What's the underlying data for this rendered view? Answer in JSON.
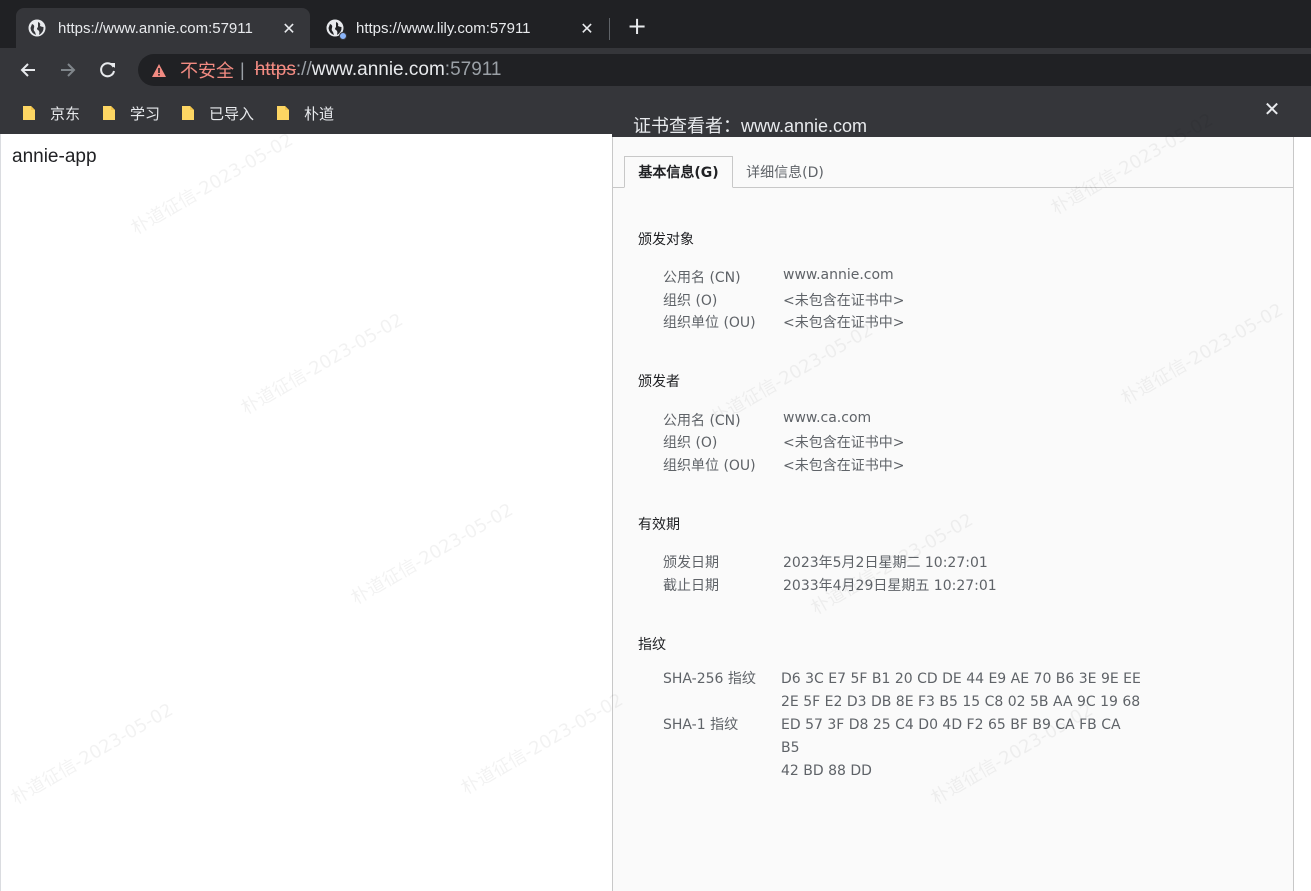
{
  "tabs": [
    {
      "title": "https://www.annie.com:57911",
      "close": "✕"
    },
    {
      "title": "https://www.lily.com:57911",
      "close": "✕"
    }
  ],
  "newtab": "+",
  "omnibox": {
    "security_label": "不安全",
    "pipe": "|",
    "scheme": "https",
    "sep": "://",
    "host": "www.annie.com",
    "port": ":57911"
  },
  "bookmarks": [
    {
      "label": "京东"
    },
    {
      "label": "学习"
    },
    {
      "label": "已导入"
    },
    {
      "label": "朴道"
    }
  ],
  "page": {
    "text": "annie-app"
  },
  "dialog": {
    "title": "证书查看者：www.annie.com",
    "close": "✕",
    "tab_general": "基本信息(G)",
    "tab_details": "详细信息(D)",
    "issued_to": {
      "title": "颁发对象",
      "rows": [
        {
          "k": "公用名 (CN)",
          "v": "www.annie.com"
        },
        {
          "k": "组织 (O)",
          "v": "<未包含在证书中>"
        },
        {
          "k": "组织单位 (OU)",
          "v": "<未包含在证书中>"
        }
      ]
    },
    "issued_by": {
      "title": "颁发者",
      "rows": [
        {
          "k": "公用名 (CN)",
          "v": "www.ca.com"
        },
        {
          "k": "组织 (O)",
          "v": "<未包含在证书中>"
        },
        {
          "k": "组织单位 (OU)",
          "v": "<未包含在证书中>"
        }
      ]
    },
    "validity": {
      "title": "有效期",
      "rows": [
        {
          "k": "颁发日期",
          "v": "2023年5月2日星期二 10:27:01"
        },
        {
          "k": "截止日期",
          "v": "2033年4月29日星期五 10:27:01"
        }
      ]
    },
    "fingerprints": {
      "title": "指纹",
      "sha256_label": "SHA-256 指纹",
      "sha256_line1": "D6 3C E7 5F B1 20 CD DE 44 E9 AE 70 B6 3E 9E EE",
      "sha256_line2": "2E 5F E2 D3 DB 8E F3 B5 15 C8 02 5B AA 9C 19 68",
      "sha1_label": "SHA-1 指纹",
      "sha1_line1": "ED 57 3F D8 25 C4 D0 4D F2 65 BF B9 CA FB CA B5",
      "sha1_line2": "42 BD 88 DD"
    }
  },
  "watermark": "朴道征信-2023-05-02",
  "colors": {
    "tabstrip": "#202124",
    "toolbar": "#35363a",
    "warning": "#f28b82",
    "folder": "#fdd663"
  }
}
